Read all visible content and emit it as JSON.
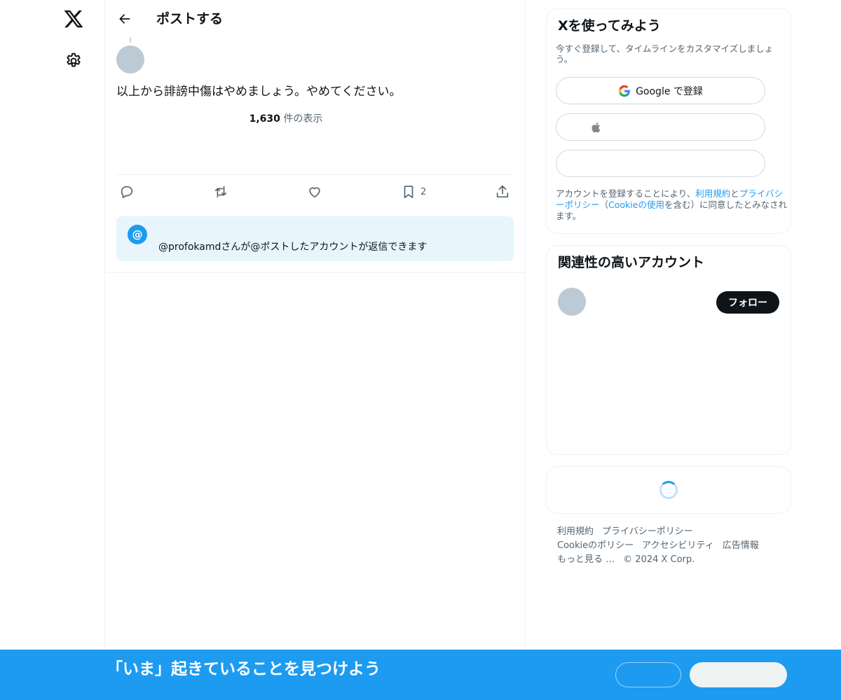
{
  "header": {
    "title": "ポストする"
  },
  "post": {
    "text": "以上から誹謗中傷はやめましょう。やめてください。",
    "views_count": "1,630",
    "views_label": " 件の表示",
    "bookmark_count": "2"
  },
  "reply_restriction": {
    "text": "@profokamdさんが@ポストしたアカウントが返信できます",
    "icon_glyph": "@"
  },
  "signup": {
    "title": "Xを使ってみよう",
    "subtitle": "今すぐ登録して、タイムラインをカスタマイズしましょう。",
    "google_label": "Google で登録",
    "terms_prefix": "アカウントを登録することにより、",
    "terms_link": "利用規約",
    "terms_mid": "と",
    "privacy_link": "プライバシーポリシー",
    "paren_open": "（",
    "cookie_link": "Cookieの使用",
    "terms_suffix": "を含む）に同意したとみなされます。"
  },
  "relevant": {
    "title": "関連性の高いアカウント",
    "follow_label": "フォロー"
  },
  "footer": {
    "links_row1": [
      "利用規約",
      "プライバシーポリシー"
    ],
    "links_row2": [
      "Cookieのポリシー",
      "アクセシビリティ",
      "広告情報"
    ],
    "more": "もっと見る …",
    "copyright": "© 2024 X Corp."
  },
  "banner": {
    "text": "「いま」起きていることを見つけよう"
  },
  "colors": {
    "accent": "#1d9bf0",
    "text": "#0f1419",
    "muted": "#536471",
    "banner_bg": "#1d9bf0"
  },
  "icons": {
    "nav": [
      "x-logo-icon",
      "gear-icon"
    ],
    "back": "arrow-left-icon",
    "actions": [
      "reply-icon",
      "repost-icon",
      "like-icon",
      "bookmark-icon",
      "share-icon"
    ],
    "signup": [
      "google-icon",
      "apple-icon"
    ]
  }
}
